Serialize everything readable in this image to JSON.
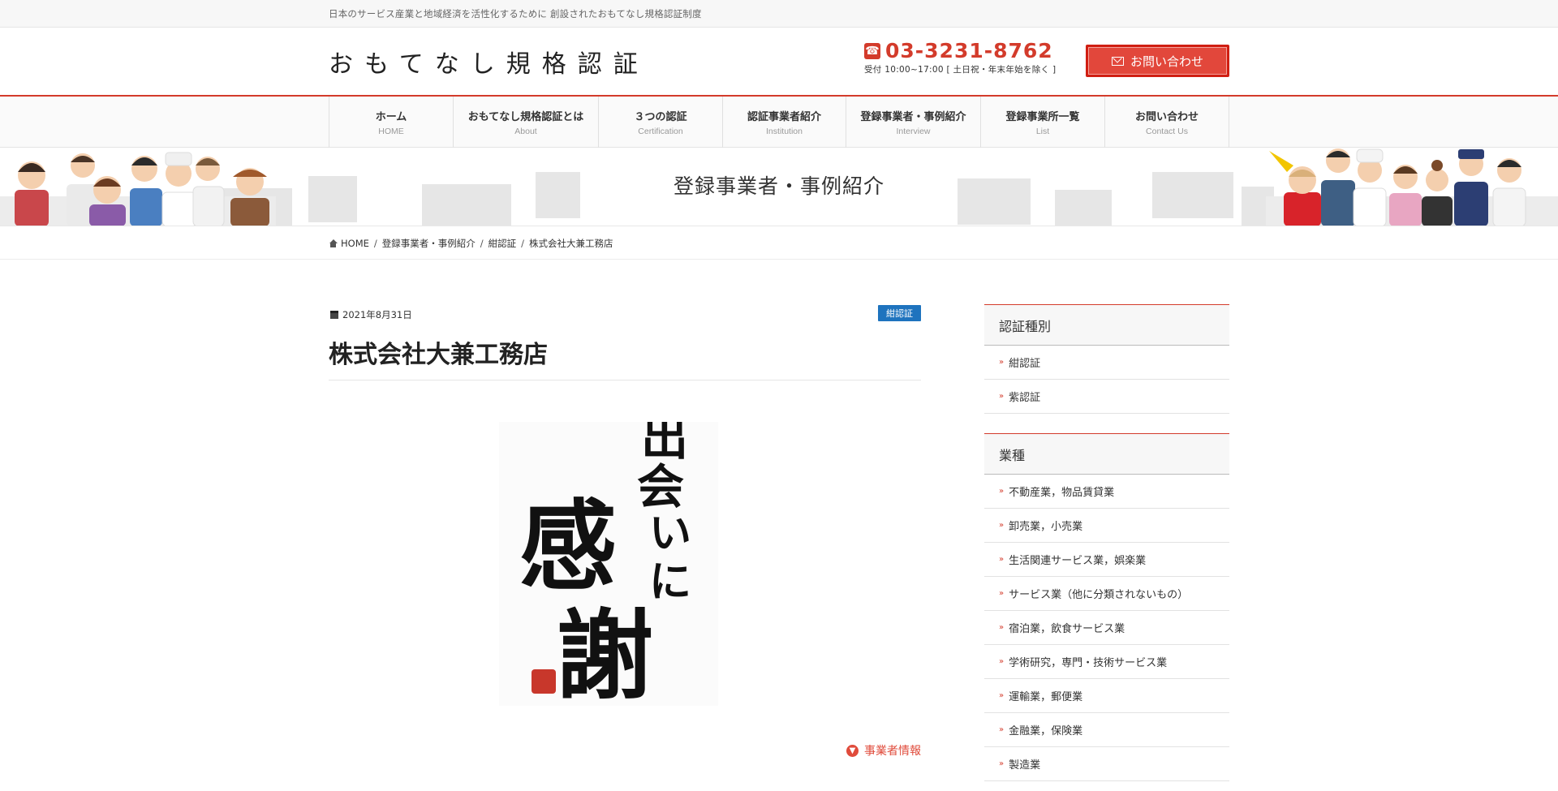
{
  "topbar": {
    "tagline": "日本のサービス産業と地域経済を活性化するために 創設されたおもてなし規格認証制度"
  },
  "header": {
    "site_title": "おもてなし規格認証",
    "phone_number": "03-3231-8762",
    "phone_hours": "受付 10:00~17:00 [ 土日祝・年末年始を除く ]",
    "contact_button": "お問い合わせ"
  },
  "nav": [
    {
      "jp": "ホーム",
      "en": "HOME"
    },
    {
      "jp": "おもてなし規格認証とは",
      "en": "About"
    },
    {
      "jp": "３つの認証",
      "en": "Certification"
    },
    {
      "jp": "認証事業者紹介",
      "en": "Institution"
    },
    {
      "jp": "登録事業者・事例紹介",
      "en": "Interview"
    },
    {
      "jp": "登録事業所一覧",
      "en": "List"
    },
    {
      "jp": "お問い合わせ",
      "en": "Contact Us"
    }
  ],
  "banner": {
    "title": "登録事業者・事例紹介"
  },
  "breadcrumb": {
    "home": "HOME",
    "level1": "登録事業者・事例紹介",
    "level2": "紺認証",
    "current": "株式会社大兼工務店"
  },
  "article": {
    "date": "2021年8月31日",
    "category": "紺認証",
    "title": "株式会社大兼工務店",
    "image_text": "出会いに感謝",
    "more_link": "事業者情報"
  },
  "sidebar": {
    "cert_title": "認証種別",
    "cert_items": [
      "紺認証",
      "紫認証"
    ],
    "industry_title": "業種",
    "industry_items": [
      "不動産業，物品賃貸業",
      "卸売業，小売業",
      "生活関連サービス業，娯楽業",
      "サービス業（他に分類されないもの）",
      "宿泊業，飲食サービス業",
      "学術研究，専門・技術サービス業",
      "運輸業，郵便業",
      "金融業，保険業",
      "製造業"
    ]
  },
  "colors": {
    "accent": "#d33b2b",
    "badge": "#1e73be",
    "link": "#e04b3b"
  }
}
